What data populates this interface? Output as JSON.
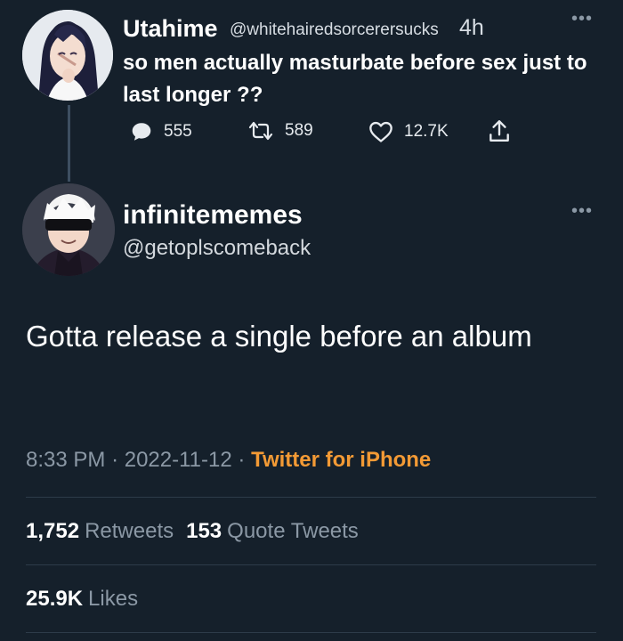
{
  "parent_tweet": {
    "display_name": "Utahime",
    "handle": "@whitehairedsorcerersucks",
    "time": "4h",
    "more_icon": "more-dots-icon",
    "text": "so men actually masturbate before sex just to last longer ??",
    "actions": {
      "replies": "555",
      "retweets": "589",
      "likes": "12.7K"
    }
  },
  "main_tweet": {
    "display_name": "infinitememes",
    "handle": "@getoplscomeback",
    "more_icon": "more-dots-icon",
    "text": "Gotta release a single before an album",
    "meta": {
      "time": "8:33 PM",
      "separator": "·",
      "date": "2022-11-12",
      "source": "Twitter for iPhone"
    },
    "stats": {
      "retweets_count": "1,752",
      "retweets_label": "Retweets",
      "quotes_count": "153",
      "quotes_label": "Quote Tweets",
      "likes_count": "25.9K",
      "likes_label": "Likes"
    }
  },
  "colors": {
    "background": "#15202b",
    "source_accent": "#f39a35",
    "muted_text": "#8b98a5"
  }
}
